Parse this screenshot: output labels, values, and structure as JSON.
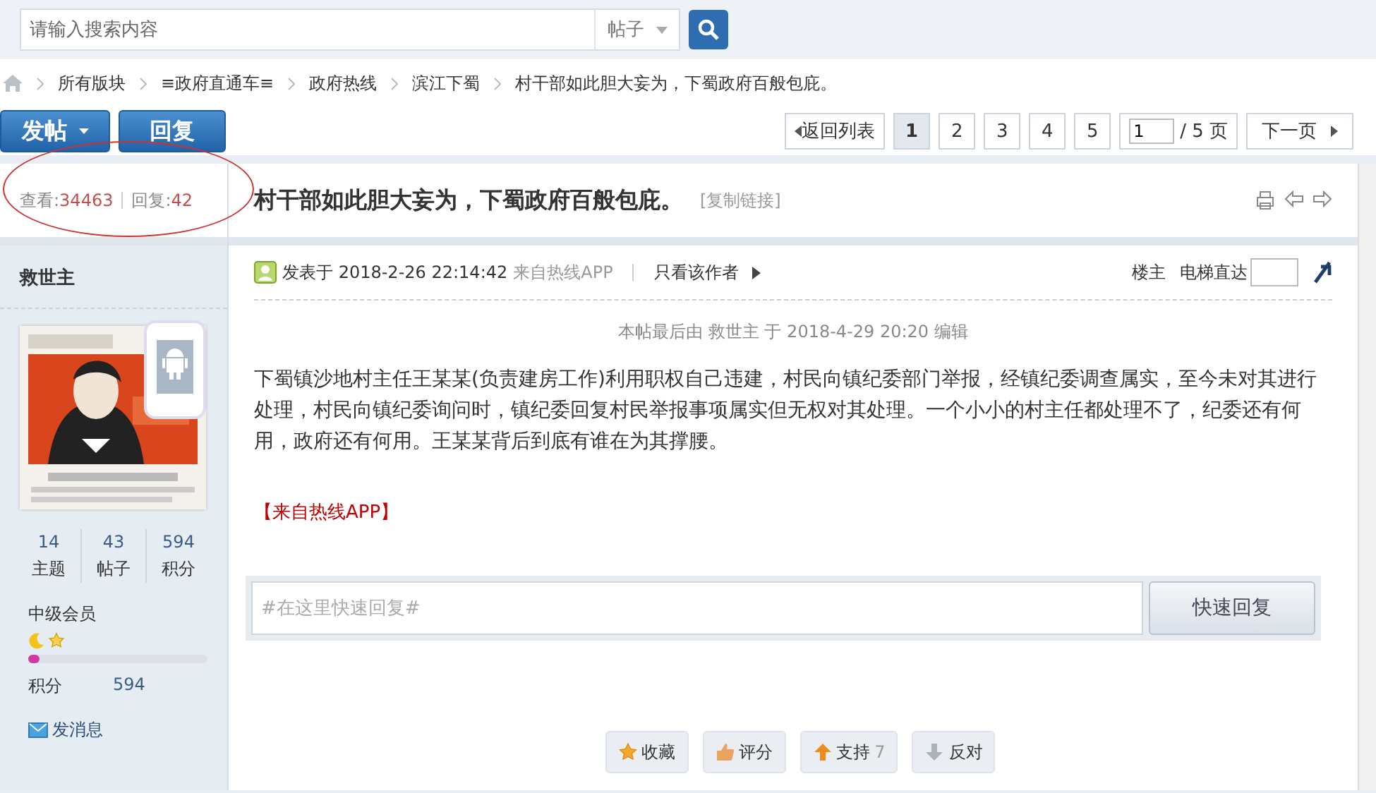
{
  "search": {
    "placeholder": "请输入搜索内容",
    "scope": "帖子"
  },
  "breadcrumb": [
    "所有版块",
    "≡政府直通车≡",
    "政府热线",
    "滨江下蜀",
    "村干部如此胆大妄为，下蜀政府百般包庇。"
  ],
  "buttons": {
    "post": "发帖",
    "reply": "回复"
  },
  "pagination": {
    "back": "返回列表",
    "pages": [
      {
        "label": "1",
        "selected": true
      },
      {
        "label": "2",
        "selected": false
      },
      {
        "label": "3",
        "selected": false
      },
      {
        "label": "4",
        "selected": false
      },
      {
        "label": "5",
        "selected": false
      }
    ],
    "page_input": "1",
    "total": "/ 5 页",
    "next": "下一页"
  },
  "thread": {
    "views_label": "查看:",
    "views": "34463",
    "replies_label": "回复:",
    "replies": "42",
    "title": "村干部如此胆大妄为，下蜀政府百般包庇。",
    "copy_link": "[复制链接]"
  },
  "author": {
    "name": "救世主",
    "stats": [
      {
        "value": "14",
        "label": "主题"
      },
      {
        "value": "43",
        "label": "帖子"
      },
      {
        "value": "594",
        "label": "积分"
      }
    ],
    "rank": "中级会员",
    "level": 0.06,
    "points_label": "积分",
    "points": "594",
    "message": "发消息"
  },
  "post": {
    "posted": "发表于 2018-2-26 22:14:42",
    "source": "来自热线APP",
    "only_author": "只看该作者",
    "floor": "楼主",
    "jump_label": "电梯直达",
    "edited": "本帖最后由 救世主 于 2018-4-29 20:20 编辑",
    "body": "下蜀镇沙地村主任王某某(负责建房工作)利用职权自己违建，村民向镇纪委部门举报，经镇纪委调查属实，至今未对其进行处理，村民向镇纪委询问时，镇纪委回复村民举报事项属实但无权对其处理。一个小小的村主任都处理不了，纪委还有何用，政府还有何用。王某某背后到底有谁在为其撑腰。",
    "source_tag": "【来自热线APP】"
  },
  "quick_reply": {
    "placeholder": "#在这里快速回复#",
    "button": "快速回复"
  },
  "post_actions": [
    {
      "kind": "favorite",
      "label": "收藏"
    },
    {
      "kind": "rate",
      "label": "评分"
    },
    {
      "kind": "support",
      "label": "支持",
      "count": "7"
    },
    {
      "kind": "oppose",
      "label": "反对"
    }
  ]
}
